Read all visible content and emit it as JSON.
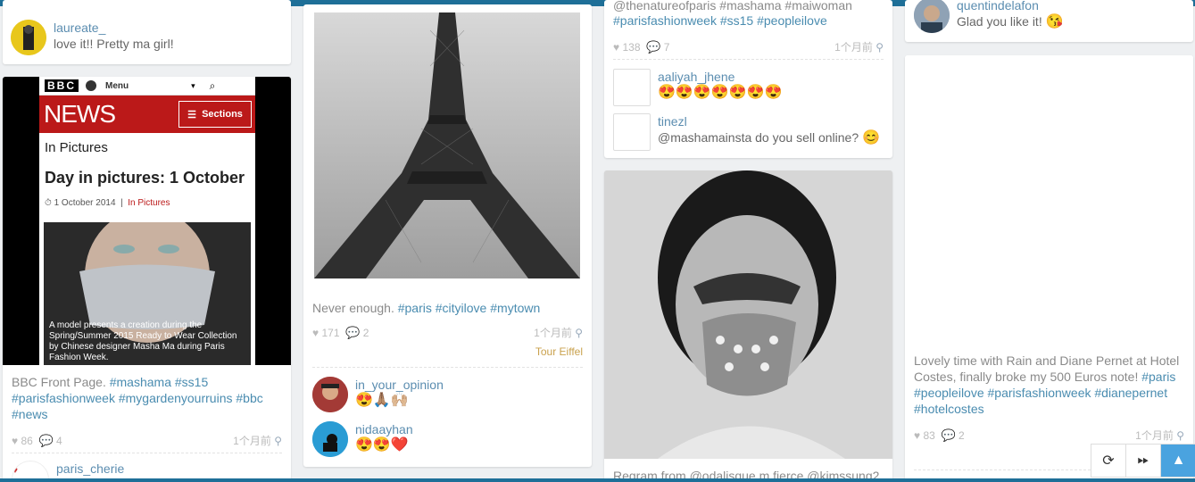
{
  "col1": {
    "top_comment": {
      "user": "laureate_",
      "text": "love it!! Pretty ma girl!"
    },
    "bbc_post": {
      "screen": {
        "logo": "BBC",
        "menu": "Menu",
        "news": "NEWS",
        "sections": "Sections",
        "in_pictures": "In Pictures",
        "headline": "Day in pictures: 1 October",
        "date": "1 October 2014",
        "category": "In Pictures",
        "photo_caption": "A model presents a creation during the Spring/Summer 2015 Ready to Wear Collection by Chinese designer Masha Ma during Paris Fashion Week."
      },
      "caption_text": "BBC Front Page.",
      "tags": [
        "#mashama",
        "#ss15",
        "#parisfashionweek",
        "#mygardenyourruins",
        "#bbc",
        "#news"
      ],
      "likes": "86",
      "comments": "4",
      "time": "1个月前",
      "next_comment_user": "paris_cherie"
    }
  },
  "col2": {
    "eiffel_post": {
      "caption_text": "Never enough.",
      "tags": [
        "#paris",
        "#cityilove",
        "#mytown"
      ],
      "likes": "171",
      "comments": "2",
      "time": "1个月前",
      "location": "Tour Eiffel",
      "comments_list": [
        {
          "user": "in_your_opinion",
          "emoji": "😍🙏🏽🙌🏼"
        },
        {
          "user": "nidaayhan",
          "emoji": "😍😍❤️"
        }
      ]
    }
  },
  "col3": {
    "top_post": {
      "caption_partial": "@thenatureofparis #mashama #maiwoman",
      "tags": [
        "#parisfashionweek",
        "#ss15",
        "#peopleilove"
      ],
      "likes": "138",
      "comments": "7",
      "time": "1个月前",
      "comments_list": [
        {
          "user": "aaliyah_jhene",
          "text": "",
          "emoji": "😍😍😍😍😍😍😍"
        },
        {
          "user": "tinezl",
          "text": "@mashamainsta do you sell online?",
          "emoji": "😊"
        }
      ]
    },
    "mask_post": {
      "caption_partial": "Regram from @odalisque m fierce @kimssung2"
    }
  },
  "col4": {
    "top_comment": {
      "user": "quentindelafon",
      "text": "Glad you like it!",
      "emoji": "😘"
    },
    "costes_post": {
      "caption_text": "Lovely time with Rain and Diane Pernet at Hotel Costes, finally broke my 500 Euros note!",
      "tags": [
        "#paris",
        "#peopleilove",
        "#parisfashionweek",
        "#dianepernet",
        "#hotelcostes"
      ],
      "likes": "83",
      "comments": "2",
      "time": "1个月前"
    }
  },
  "controls": {
    "refresh_icon": "refresh-icon",
    "forward_icon": "fast-forward-icon",
    "up_icon": "arrow-up-icon"
  },
  "colors": {
    "accent": "#1e6f98",
    "tag": "#4a8cb0",
    "bbc_red": "#bb1919",
    "scroll_top": "#4aa3df"
  }
}
